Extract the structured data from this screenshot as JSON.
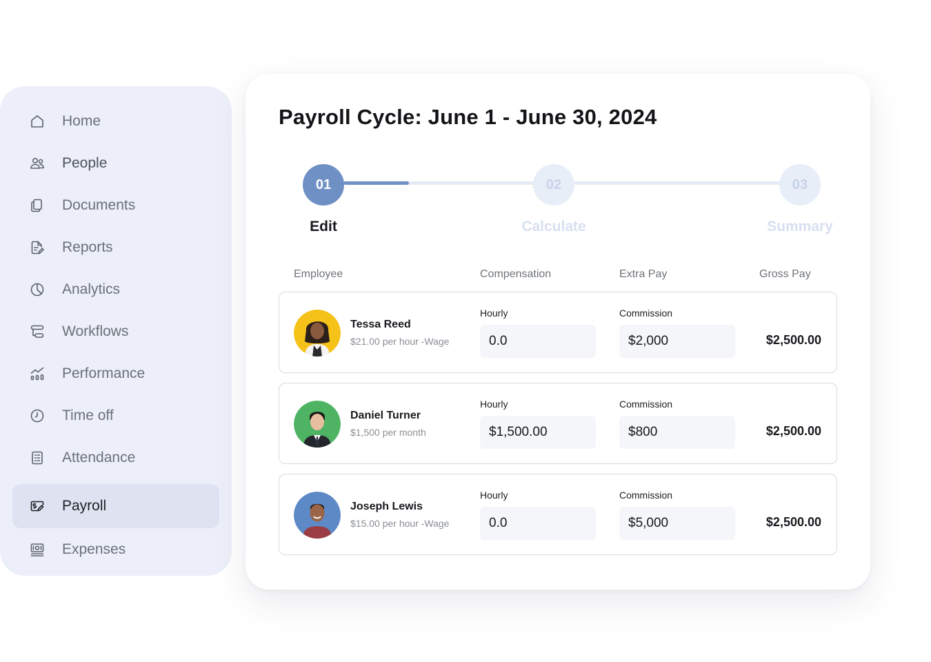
{
  "sidebar": {
    "items": [
      {
        "label": "Home",
        "icon": "home-icon"
      },
      {
        "label": "People",
        "icon": "people-icon"
      },
      {
        "label": "Documents",
        "icon": "documents-icon"
      },
      {
        "label": "Reports",
        "icon": "reports-icon"
      },
      {
        "label": "Analytics",
        "icon": "pie-chart-icon"
      },
      {
        "label": "Workflows",
        "icon": "workflow-icon"
      },
      {
        "label": "Performance",
        "icon": "performance-icon"
      },
      {
        "label": "Time off",
        "icon": "clock-icon"
      },
      {
        "label": "Attendance",
        "icon": "attendance-icon"
      },
      {
        "label": "Payroll",
        "icon": "payroll-icon",
        "active": true
      },
      {
        "label": "Expenses",
        "icon": "expenses-icon"
      }
    ]
  },
  "main": {
    "title": "Payroll Cycle: June 1 - June 30, 2024",
    "stepper": {
      "progress": 0.15,
      "steps": [
        {
          "number": "01",
          "label": "Edit",
          "active": true
        },
        {
          "number": "02",
          "label": "Calculate",
          "active": false
        },
        {
          "number": "03",
          "label": "Summary",
          "active": false
        }
      ]
    },
    "table": {
      "headers": [
        "Employee",
        "Compensation",
        "Extra Pay",
        "Gross Pay"
      ],
      "rows": [
        {
          "name": "Tessa Reed",
          "rate": "$21.00 per hour -Wage",
          "comp_label": "Hourly",
          "comp_value": "0.0",
          "extra_label": "Commission",
          "extra_value": "$2,000",
          "gross": "$2,500.00",
          "avatar_bg": "#f5c21a"
        },
        {
          "name": "Daniel Turner",
          "rate": "$1,500 per month",
          "comp_label": "Hourly",
          "comp_value": "$1,500.00",
          "extra_label": "Commission",
          "extra_value": "$800",
          "gross": "$2,500.00",
          "avatar_bg": "#4fb364"
        },
        {
          "name": "Joseph Lewis",
          "rate": "$15.00 per hour -Wage",
          "comp_label": "Hourly",
          "comp_value": "0.0",
          "extra_label": "Commission",
          "extra_value": "$5,000",
          "gross": "$2,500.00",
          "avatar_bg": "#5d89c7"
        }
      ]
    }
  },
  "colors": {
    "accent": "#6f90c4",
    "sidebar_bg": "#eceff9",
    "active_item_bg": "#dfe3f1"
  }
}
